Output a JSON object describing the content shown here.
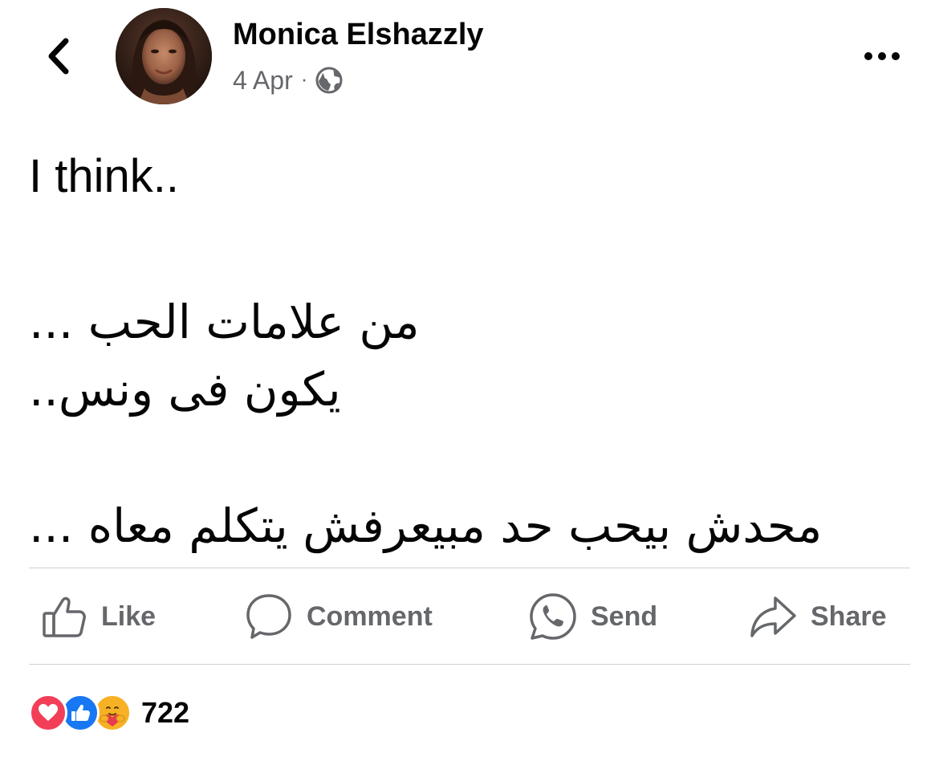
{
  "header": {
    "author_name": "Monica Elshazzly",
    "date": "4 Apr",
    "separator": "·",
    "privacy_icon": "globe-icon",
    "back_icon": "chevron-left-icon",
    "more_icon": "more-horizontal-icon"
  },
  "post": {
    "lines": [
      "I think..",
      "من علامات الحب ...",
      "يكون فى ونس..",
      "محدش بيحب حد مبيعرفش يتكلم معاه ..."
    ]
  },
  "actions": {
    "like": {
      "label": "Like",
      "icon": "thumbs-up-icon"
    },
    "comment": {
      "label": "Comment",
      "icon": "comment-bubble-icon"
    },
    "send": {
      "label": "Send",
      "icon": "messenger-whatsapp-icon"
    },
    "share": {
      "label": "Share",
      "icon": "share-arrow-icon"
    }
  },
  "reactions": {
    "types": [
      "love",
      "like",
      "care"
    ],
    "count": "722"
  },
  "colors": {
    "text_primary": "#050505",
    "text_secondary": "#65676b",
    "divider": "#ced0d4",
    "like_blue": "#1877f2",
    "love_red": "#f33e58",
    "care_yellow": "#f7b125"
  }
}
